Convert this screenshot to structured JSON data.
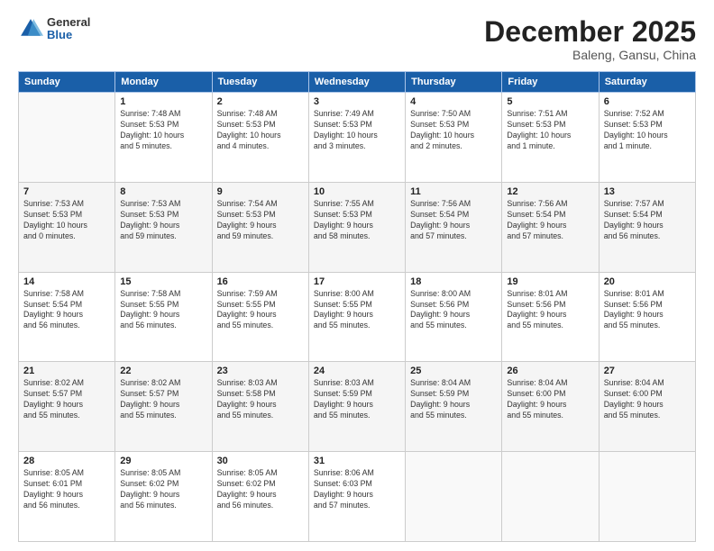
{
  "header": {
    "logo_general": "General",
    "logo_blue": "Blue",
    "month_title": "December 2025",
    "location": "Baleng, Gansu, China"
  },
  "weekdays": [
    "Sunday",
    "Monday",
    "Tuesday",
    "Wednesday",
    "Thursday",
    "Friday",
    "Saturday"
  ],
  "weeks": [
    [
      {
        "day": "",
        "info": ""
      },
      {
        "day": "1",
        "info": "Sunrise: 7:48 AM\nSunset: 5:53 PM\nDaylight: 10 hours\nand 5 minutes."
      },
      {
        "day": "2",
        "info": "Sunrise: 7:48 AM\nSunset: 5:53 PM\nDaylight: 10 hours\nand 4 minutes."
      },
      {
        "day": "3",
        "info": "Sunrise: 7:49 AM\nSunset: 5:53 PM\nDaylight: 10 hours\nand 3 minutes."
      },
      {
        "day": "4",
        "info": "Sunrise: 7:50 AM\nSunset: 5:53 PM\nDaylight: 10 hours\nand 2 minutes."
      },
      {
        "day": "5",
        "info": "Sunrise: 7:51 AM\nSunset: 5:53 PM\nDaylight: 10 hours\nand 1 minute."
      },
      {
        "day": "6",
        "info": "Sunrise: 7:52 AM\nSunset: 5:53 PM\nDaylight: 10 hours\nand 1 minute."
      }
    ],
    [
      {
        "day": "7",
        "info": "Sunrise: 7:53 AM\nSunset: 5:53 PM\nDaylight: 10 hours\nand 0 minutes."
      },
      {
        "day": "8",
        "info": "Sunrise: 7:53 AM\nSunset: 5:53 PM\nDaylight: 9 hours\nand 59 minutes."
      },
      {
        "day": "9",
        "info": "Sunrise: 7:54 AM\nSunset: 5:53 PM\nDaylight: 9 hours\nand 59 minutes."
      },
      {
        "day": "10",
        "info": "Sunrise: 7:55 AM\nSunset: 5:53 PM\nDaylight: 9 hours\nand 58 minutes."
      },
      {
        "day": "11",
        "info": "Sunrise: 7:56 AM\nSunset: 5:54 PM\nDaylight: 9 hours\nand 57 minutes."
      },
      {
        "day": "12",
        "info": "Sunrise: 7:56 AM\nSunset: 5:54 PM\nDaylight: 9 hours\nand 57 minutes."
      },
      {
        "day": "13",
        "info": "Sunrise: 7:57 AM\nSunset: 5:54 PM\nDaylight: 9 hours\nand 56 minutes."
      }
    ],
    [
      {
        "day": "14",
        "info": "Sunrise: 7:58 AM\nSunset: 5:54 PM\nDaylight: 9 hours\nand 56 minutes."
      },
      {
        "day": "15",
        "info": "Sunrise: 7:58 AM\nSunset: 5:55 PM\nDaylight: 9 hours\nand 56 minutes."
      },
      {
        "day": "16",
        "info": "Sunrise: 7:59 AM\nSunset: 5:55 PM\nDaylight: 9 hours\nand 55 minutes."
      },
      {
        "day": "17",
        "info": "Sunrise: 8:00 AM\nSunset: 5:55 PM\nDaylight: 9 hours\nand 55 minutes."
      },
      {
        "day": "18",
        "info": "Sunrise: 8:00 AM\nSunset: 5:56 PM\nDaylight: 9 hours\nand 55 minutes."
      },
      {
        "day": "19",
        "info": "Sunrise: 8:01 AM\nSunset: 5:56 PM\nDaylight: 9 hours\nand 55 minutes."
      },
      {
        "day": "20",
        "info": "Sunrise: 8:01 AM\nSunset: 5:56 PM\nDaylight: 9 hours\nand 55 minutes."
      }
    ],
    [
      {
        "day": "21",
        "info": "Sunrise: 8:02 AM\nSunset: 5:57 PM\nDaylight: 9 hours\nand 55 minutes."
      },
      {
        "day": "22",
        "info": "Sunrise: 8:02 AM\nSunset: 5:57 PM\nDaylight: 9 hours\nand 55 minutes."
      },
      {
        "day": "23",
        "info": "Sunrise: 8:03 AM\nSunset: 5:58 PM\nDaylight: 9 hours\nand 55 minutes."
      },
      {
        "day": "24",
        "info": "Sunrise: 8:03 AM\nSunset: 5:59 PM\nDaylight: 9 hours\nand 55 minutes."
      },
      {
        "day": "25",
        "info": "Sunrise: 8:04 AM\nSunset: 5:59 PM\nDaylight: 9 hours\nand 55 minutes."
      },
      {
        "day": "26",
        "info": "Sunrise: 8:04 AM\nSunset: 6:00 PM\nDaylight: 9 hours\nand 55 minutes."
      },
      {
        "day": "27",
        "info": "Sunrise: 8:04 AM\nSunset: 6:00 PM\nDaylight: 9 hours\nand 55 minutes."
      }
    ],
    [
      {
        "day": "28",
        "info": "Sunrise: 8:05 AM\nSunset: 6:01 PM\nDaylight: 9 hours\nand 56 minutes."
      },
      {
        "day": "29",
        "info": "Sunrise: 8:05 AM\nSunset: 6:02 PM\nDaylight: 9 hours\nand 56 minutes."
      },
      {
        "day": "30",
        "info": "Sunrise: 8:05 AM\nSunset: 6:02 PM\nDaylight: 9 hours\nand 56 minutes."
      },
      {
        "day": "31",
        "info": "Sunrise: 8:06 AM\nSunset: 6:03 PM\nDaylight: 9 hours\nand 57 minutes."
      },
      {
        "day": "",
        "info": ""
      },
      {
        "day": "",
        "info": ""
      },
      {
        "day": "",
        "info": ""
      }
    ]
  ]
}
